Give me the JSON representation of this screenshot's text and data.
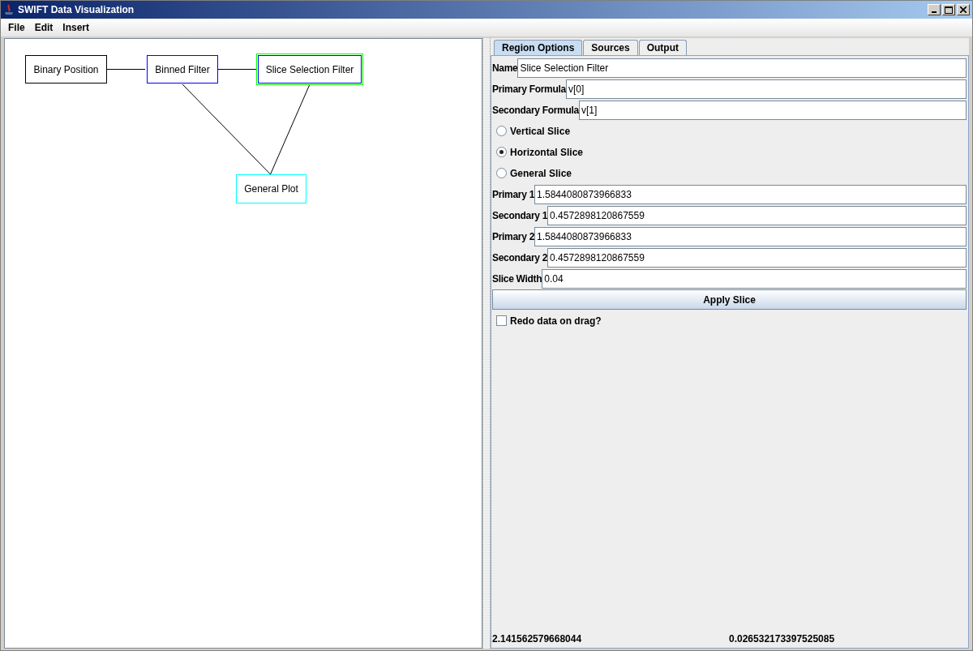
{
  "window": {
    "title": "SWIFT Data Visualization"
  },
  "menu": [
    "File",
    "Edit",
    "Insert"
  ],
  "diagram": {
    "nodes": [
      {
        "label": "Binary Position",
        "color": "#000000",
        "selected": false
      },
      {
        "label": "Binned Filter",
        "color": "#0000ff",
        "selected": false
      },
      {
        "label": "Slice Selection Filter",
        "color": "#0000ff",
        "selected": true
      },
      {
        "label": "General Plot",
        "color": "#00ffff",
        "selected": false
      }
    ]
  },
  "tabs": [
    {
      "label": "Region Options",
      "selected": true
    },
    {
      "label": "Sources",
      "selected": false
    },
    {
      "label": "Output",
      "selected": false
    }
  ],
  "form": [
    {
      "kind": "field",
      "label": "Name",
      "value": "Slice Selection Filter"
    },
    {
      "kind": "field",
      "label": "Primary Formula",
      "value": "v[0]"
    },
    {
      "kind": "field",
      "label": "Secondary Formula",
      "value": "v[1]"
    },
    {
      "kind": "radio",
      "label": "Vertical Slice",
      "selected": false
    },
    {
      "kind": "radio",
      "label": "Horizontal Slice",
      "selected": true
    },
    {
      "kind": "radio",
      "label": "General Slice",
      "selected": false
    },
    {
      "kind": "field",
      "label": "Primary 1",
      "value": "1.5844080873966833"
    },
    {
      "kind": "field",
      "label": "Secondary 1",
      "value": "0.4572898120867559"
    },
    {
      "kind": "field",
      "label": "Primary 2",
      "value": "1.5844080873966833"
    },
    {
      "kind": "field",
      "label": "Secondary 2",
      "value": "0.4572898120867559"
    },
    {
      "kind": "field",
      "label": "Slice Width",
      "value": "0.04"
    },
    {
      "kind": "button",
      "label": "Apply Slice"
    },
    {
      "kind": "checkbox",
      "label": "Redo data on drag?",
      "checked": false
    }
  ],
  "status": [
    "2.141562579668044",
    "0.026532173397525085"
  ]
}
